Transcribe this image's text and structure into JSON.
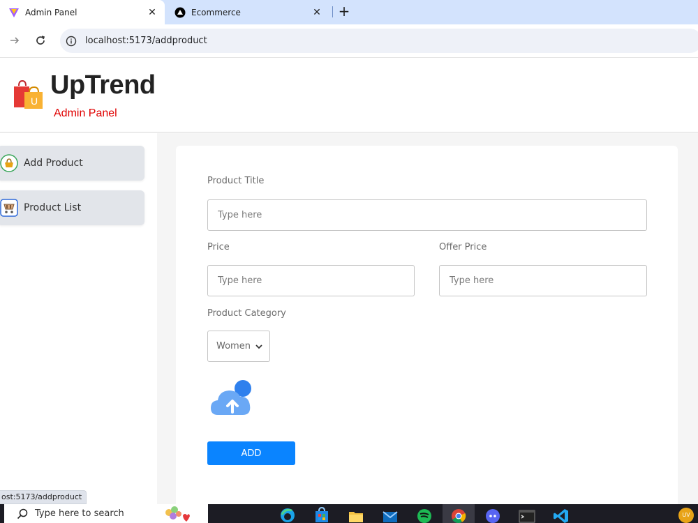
{
  "browser": {
    "tabs": [
      {
        "title": "Admin Panel",
        "active": true
      },
      {
        "title": "Ecommerce",
        "active": false
      }
    ],
    "url_host": "localhost",
    "url_rest": ":5173/addproduct",
    "status_url": "ost:5173/addproduct"
  },
  "header": {
    "brand": "UpTrend",
    "subtitle": "Admin Panel",
    "logo_letter": "U"
  },
  "sidebar": {
    "items": [
      {
        "label": "Add Product"
      },
      {
        "label": "Product List"
      }
    ]
  },
  "form": {
    "title_label": "Product Title",
    "title_placeholder": "Type here",
    "price_label": "Price",
    "price_placeholder": "Type here",
    "offer_label": "Offer Price",
    "offer_placeholder": "Type here",
    "category_label": "Product Category",
    "category_value": "Women",
    "add_button": "ADD"
  },
  "taskbar": {
    "search_placeholder": "Type here to search",
    "user_initials": "UV"
  },
  "colors": {
    "accent": "#0a84ff",
    "brand_red": "#e00000"
  }
}
